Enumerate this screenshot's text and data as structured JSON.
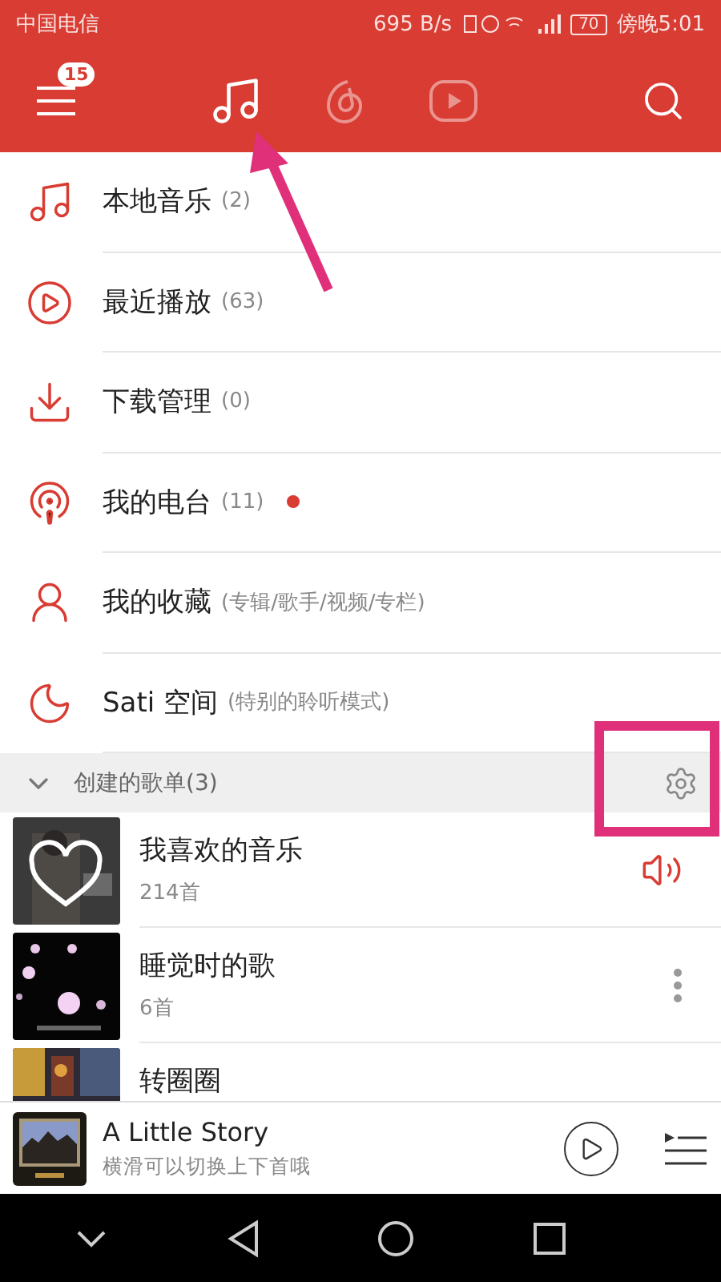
{
  "status_bar": {
    "carrier": "中国电信",
    "speed": "695 B/s",
    "battery": "70",
    "time": "傍晚5:01"
  },
  "header": {
    "badge": "15",
    "tabs": [
      {
        "kind": "music",
        "selected": true
      },
      {
        "kind": "radio",
        "selected": false
      },
      {
        "kind": "video",
        "selected": false
      }
    ]
  },
  "menu": [
    {
      "kind": "local",
      "label": "本地音乐",
      "count": "(2)",
      "dot": false
    },
    {
      "kind": "recent",
      "label": "最近播放",
      "count": "(63)",
      "dot": false
    },
    {
      "kind": "download",
      "label": "下载管理",
      "count": "(0)",
      "dot": false
    },
    {
      "kind": "radio",
      "label": "我的电台",
      "count": "(11)",
      "dot": true
    },
    {
      "kind": "collect",
      "label": "我的收藏",
      "count": "(专辑/歌手/视频/专栏)",
      "dot": false
    },
    {
      "kind": "sati",
      "label": "Sati 空间",
      "count": "(特别的聆听模式)",
      "dot": false
    }
  ],
  "section": {
    "title": "创建的歌单(3)",
    "expanded": true
  },
  "playlists": [
    {
      "name": "我喜欢的音乐",
      "count": "214首",
      "kind": "playing"
    },
    {
      "name": "睡觉时的歌",
      "count": "6首",
      "kind": "more"
    },
    {
      "name": "转圈圈",
      "kind": "plain"
    }
  ],
  "player": {
    "title": "A Little Story",
    "subtitle": "横滑可以切换上下首哦"
  }
}
